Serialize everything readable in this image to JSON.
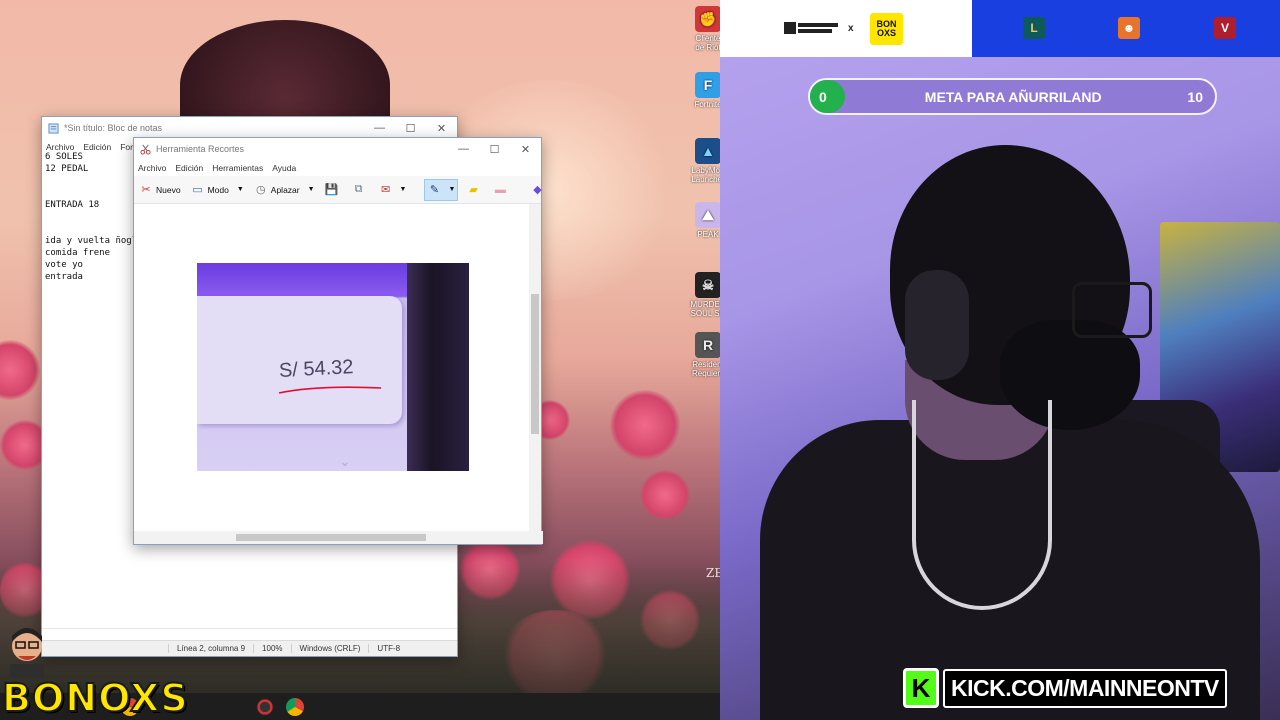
{
  "notepad": {
    "title": "*Sin título: Bloc de notas",
    "menu": [
      "Archivo",
      "Edición",
      "Formato"
    ],
    "lines": [
      "6 SOLES",
      "12 PEDAL",
      "",
      "",
      "ENTRADA 18",
      "",
      "",
      "ida y vuelta ñogl",
      "comida frene",
      "vote yo",
      "entrada"
    ],
    "status": {
      "position": "Línea 2, columna 9",
      "zoom": "100%",
      "eol": "Windows (CRLF)",
      "encoding": "UTF-8"
    }
  },
  "snip": {
    "title": "Herramienta Recortes",
    "menu": [
      "Archivo",
      "Edición",
      "Herramientas",
      "Ayuda"
    ],
    "toolbar": {
      "new": "Nuevo",
      "mode": "Modo",
      "delay": "Aplazar"
    },
    "capture_amount": "S/ 54.32"
  },
  "desktop": {
    "icons": [
      "Cliente de Riot",
      "Fortnite",
      "LabyMod Launcher",
      "PEAK",
      "MURDER SOUL SU",
      "Resident Requiem"
    ],
    "wallpaper_text": "ZE",
    "taskbar_logo": "BONOXS"
  },
  "overlay": {
    "sponsor_x": "x",
    "sponsor_badge": [
      "BON",
      "OXS"
    ],
    "goal": {
      "label": "META PARA AÑURRILAND",
      "current": "0",
      "target": "10",
      "progress": 0
    },
    "kick_url": "KICK.COM/MAINNEONTV",
    "colors": {
      "goal_fill": "#22b14c",
      "header_blue": "#1a3fe0",
      "kick_green": "#53fc18",
      "bonoxs_yellow": "#ffe600"
    }
  }
}
